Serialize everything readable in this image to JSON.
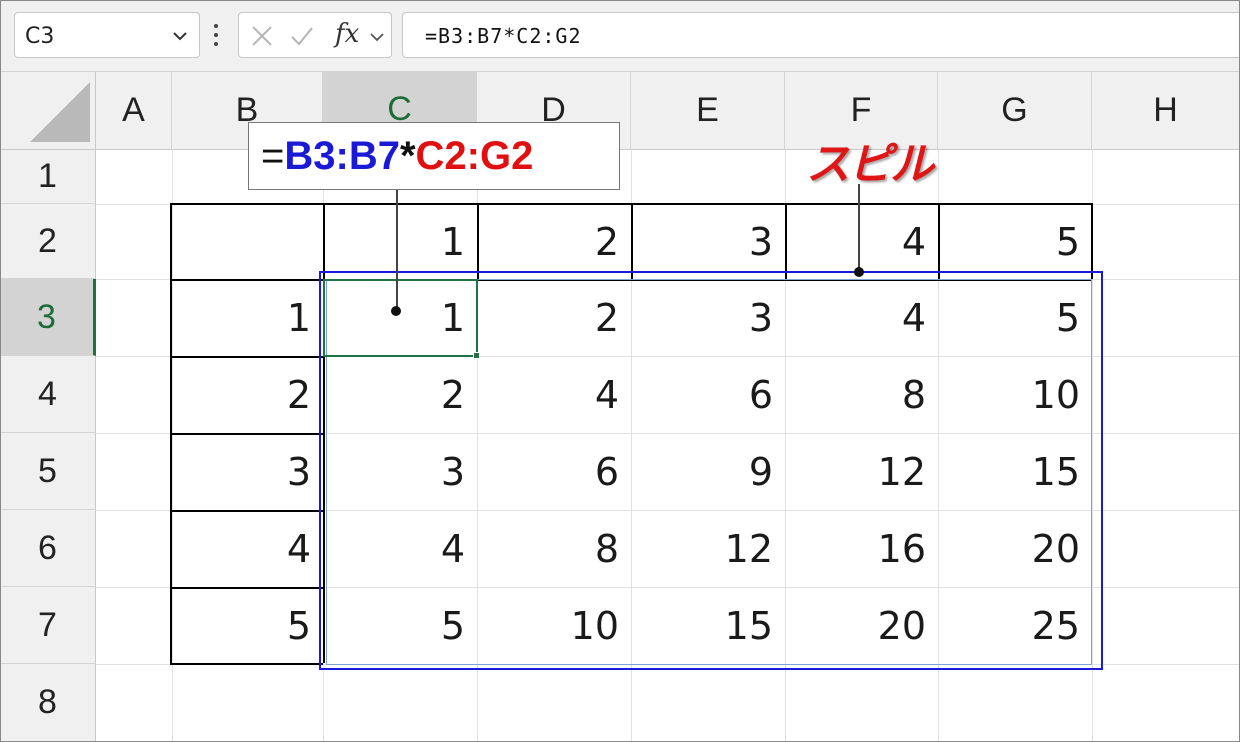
{
  "formula_bar": {
    "name_box": "C3",
    "fx_label": "fx",
    "formula": "=B3:B7*C2:G2"
  },
  "columns": [
    "A",
    "B",
    "C",
    "D",
    "E",
    "F",
    "G",
    "H"
  ],
  "rows": [
    "1",
    "2",
    "3",
    "4",
    "5",
    "6",
    "7",
    "8"
  ],
  "selected_column": "C",
  "selected_row": "3",
  "table": {
    "header_row": [
      "1",
      "2",
      "3",
      "4",
      "5"
    ],
    "header_col": [
      "1",
      "2",
      "3",
      "4",
      "5"
    ],
    "results": [
      [
        "1",
        "2",
        "3",
        "4",
        "5"
      ],
      [
        "2",
        "4",
        "6",
        "8",
        "10"
      ],
      [
        "3",
        "6",
        "9",
        "12",
        "15"
      ],
      [
        "4",
        "8",
        "12",
        "16",
        "20"
      ],
      [
        "5",
        "10",
        "15",
        "20",
        "25"
      ]
    ]
  },
  "annotations": {
    "formula_callout": {
      "eq": "=",
      "ref1": "B3:B7",
      "op": "*",
      "ref2": "C2:G2"
    },
    "spill_label": "スピル",
    "colors": {
      "spill_border": "#1a1adf",
      "ref1": "#1a1ad6",
      "ref2": "#e01010",
      "selection": "#217346"
    }
  },
  "icons": {
    "name_box_chevron": "chevron-down-icon",
    "kebab": "more-vertical-icon",
    "cancel": "close-icon",
    "enter": "check-icon",
    "formula_chevron": "chevron-down-icon"
  }
}
